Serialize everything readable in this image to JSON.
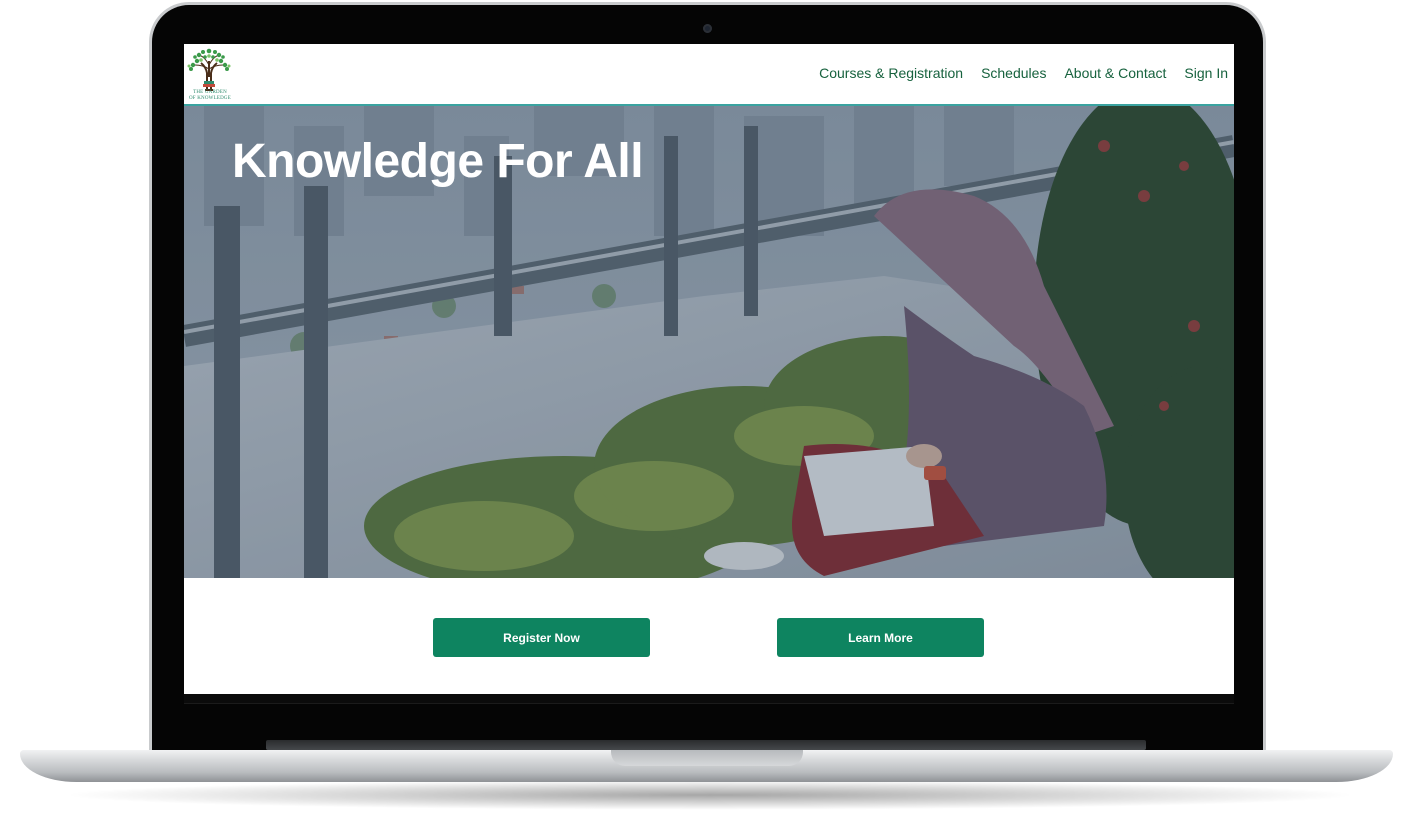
{
  "site": {
    "logo": {
      "icon": "tree-icon",
      "caption_line1": "THE GARDEN",
      "caption_line2": "OF KNOWLEDGE"
    },
    "nav": [
      {
        "label": "Courses & Registration"
      },
      {
        "label": "Schedules"
      },
      {
        "label": "About & Contact"
      },
      {
        "label": "Sign In"
      }
    ],
    "hero": {
      "title": "Knowledge For All"
    },
    "buttons": {
      "register_label": "Register Now",
      "learn_label": "Learn More"
    }
  },
  "colors": {
    "nav_text": "#17623e",
    "header_border": "#3aa3a0",
    "button_bg": "#0e8460",
    "button_text": "#ffffff",
    "hero_title": "#ffffff"
  }
}
